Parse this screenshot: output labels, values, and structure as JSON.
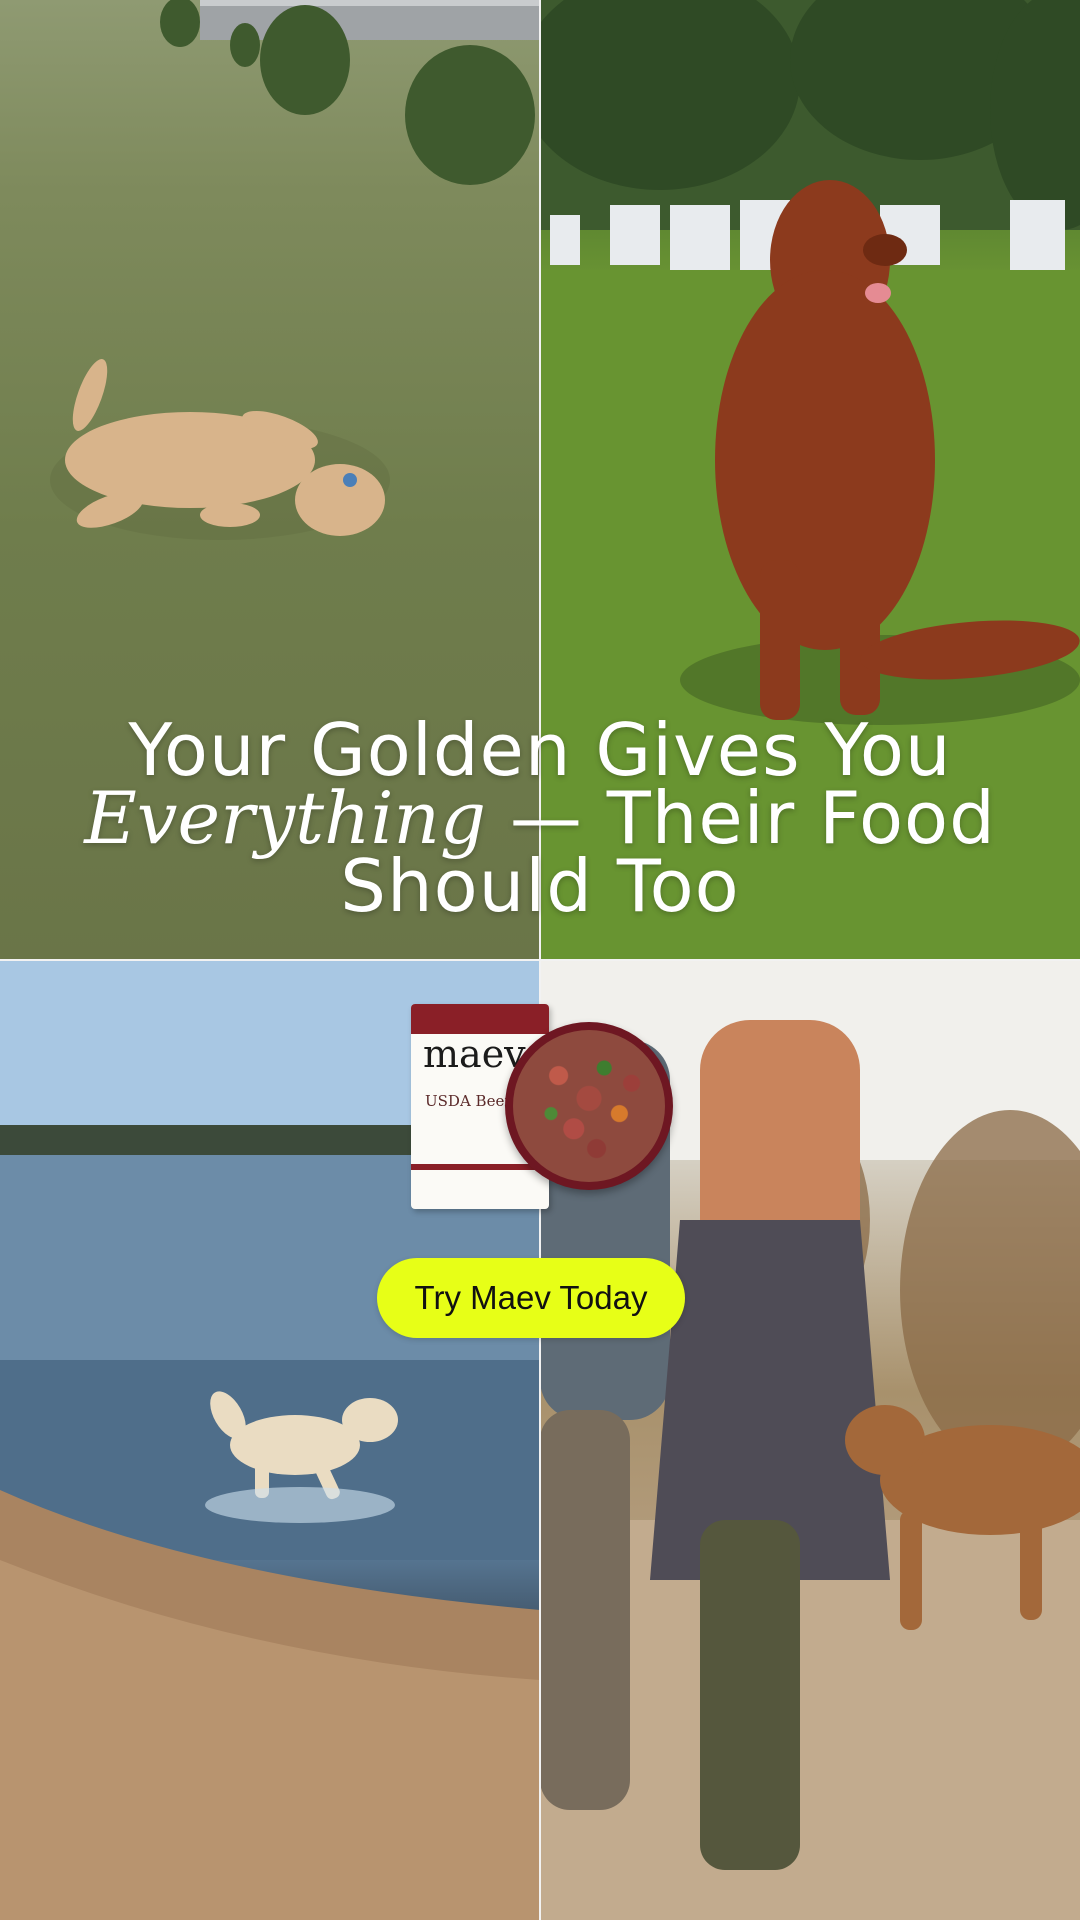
{
  "headline": {
    "line1": "Your Golden Gives You",
    "line2_italic": "Everything",
    "line2_rest": " — Their Food",
    "line3": "Should Too"
  },
  "product": {
    "brand": "maev",
    "bag_label": "USDA Beef"
  },
  "cta": {
    "label": "Try Maev Today",
    "color": "#e7ff17"
  },
  "panels": [
    {
      "scene": "dog-rolling-on-grass"
    },
    {
      "scene": "golden-retriever-sitting-on-lawn"
    },
    {
      "scene": "dog-running-in-lake-shallows"
    },
    {
      "scene": "people-walking-with-dog"
    }
  ]
}
